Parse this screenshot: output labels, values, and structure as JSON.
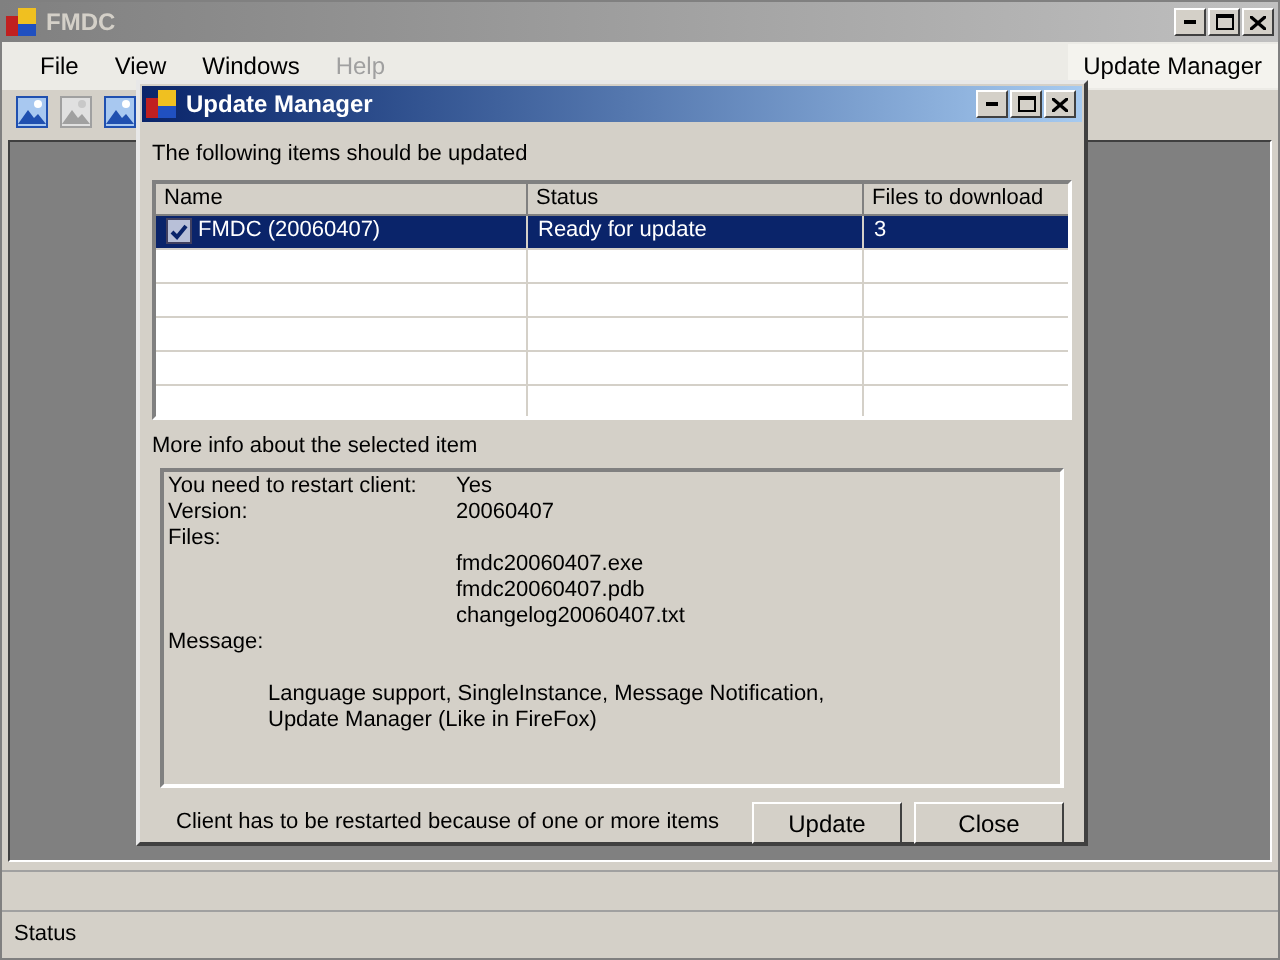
{
  "main_window": {
    "title": "FMDC",
    "menu": [
      {
        "label": "File",
        "disabled": false
      },
      {
        "label": "View",
        "disabled": false
      },
      {
        "label": "Windows",
        "disabled": false
      },
      {
        "label": "Help",
        "disabled": true
      }
    ],
    "menu_right": "Update Manager",
    "toolbar": [
      {
        "disabled": false
      },
      {
        "disabled": true
      },
      {
        "disabled": false
      }
    ],
    "status_bar": "Status"
  },
  "dialog": {
    "title": "Update Manager",
    "list_label": "The following items should be updated",
    "table": {
      "columns": [
        "Name",
        "Status",
        "Files to download"
      ],
      "rows": [
        {
          "checked": true,
          "selected": true,
          "cells": [
            "FMDC (20060407)",
            "Ready for update",
            "3"
          ]
        }
      ]
    },
    "info_label": "More info about the selected item",
    "info_rows": [
      {
        "label": "You need to restart client:",
        "value": "Yes"
      },
      {
        "label": "Version:",
        "value": "20060407"
      },
      {
        "label": "Files:"
      }
    ],
    "files": [
      "fmdc20060407.exe",
      "fmdc20060407.pdb",
      "changelog20060407.txt"
    ],
    "message_label": "Message:",
    "message_lines": [
      "Language support, SingleInstance, Message Notification,",
      "Update Manager (Like in FireFox)"
    ],
    "footer_note": "Client has to be restarted because of one or more items",
    "buttons": [
      "Update",
      "Close"
    ]
  }
}
